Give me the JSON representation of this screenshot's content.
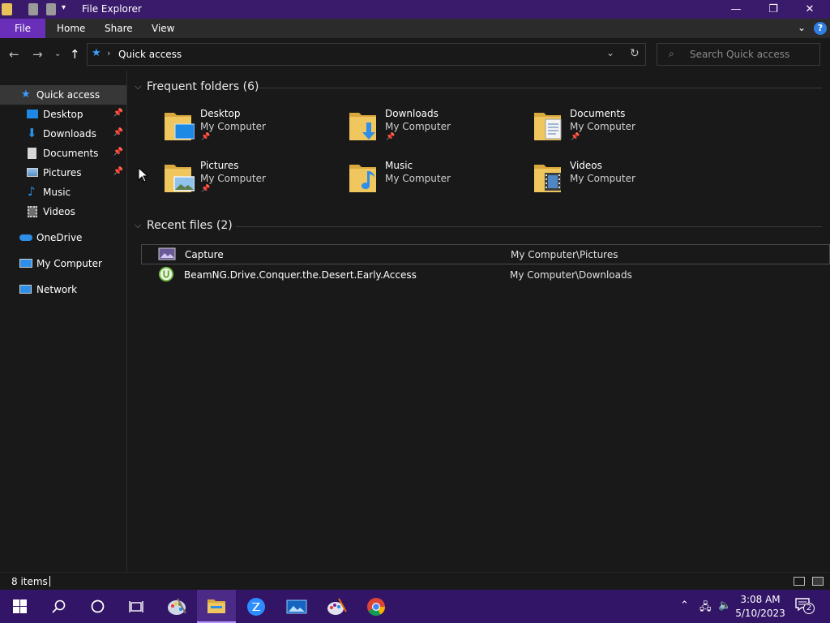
{
  "window": {
    "title": "File Explorer",
    "minimize_glyph": "—",
    "maximize_glyph": "❐",
    "close_glyph": "✕"
  },
  "ribbon": {
    "tabs": [
      "File",
      "Home",
      "Share",
      "View"
    ],
    "help_glyph": "?"
  },
  "address": {
    "path": "Quick access",
    "search_placeholder": "Search Quick access"
  },
  "sidebar": {
    "items": [
      {
        "label": "Quick access",
        "icon": "star-icon"
      },
      {
        "label": "Desktop",
        "icon": "desktop-icon",
        "pinned": true
      },
      {
        "label": "Downloads",
        "icon": "download-icon",
        "pinned": true
      },
      {
        "label": "Documents",
        "icon": "document-icon",
        "pinned": true
      },
      {
        "label": "Pictures",
        "icon": "pictures-icon",
        "pinned": true
      },
      {
        "label": "Music",
        "icon": "music-icon"
      },
      {
        "label": "Videos",
        "icon": "videos-icon"
      },
      {
        "label": "OneDrive",
        "icon": "cloud-icon"
      },
      {
        "label": "My Computer",
        "icon": "computer-icon"
      },
      {
        "label": "Network",
        "icon": "network-icon"
      }
    ]
  },
  "frequent": {
    "heading": "Frequent folders (6)",
    "folders": [
      {
        "name": "Desktop",
        "location": "My Computer",
        "pinned": true
      },
      {
        "name": "Downloads",
        "location": "My Computer",
        "pinned": true
      },
      {
        "name": "Documents",
        "location": "My Computer",
        "pinned": true
      },
      {
        "name": "Pictures",
        "location": "My Computer",
        "pinned": true
      },
      {
        "name": "Music",
        "location": "My Computer",
        "pinned": false
      },
      {
        "name": "Videos",
        "location": "My Computer",
        "pinned": false
      }
    ]
  },
  "recent": {
    "heading": "Recent files (2)",
    "files": [
      {
        "name": "Capture",
        "path": "My Computer\\Pictures"
      },
      {
        "name": "BeamNG.Drive.Conquer.the.Desert.Early.Access",
        "path": "My Computer\\Downloads"
      }
    ]
  },
  "status": {
    "items": "8 items"
  },
  "taskbar": {
    "time": "3:08 AM",
    "date": "5/10/2023",
    "notification_count": "2"
  },
  "colors": {
    "titlebar": "#3a1a6b",
    "accent": "#6a2fb8",
    "taskbar": "#321566",
    "folder": "#e8c15a"
  }
}
